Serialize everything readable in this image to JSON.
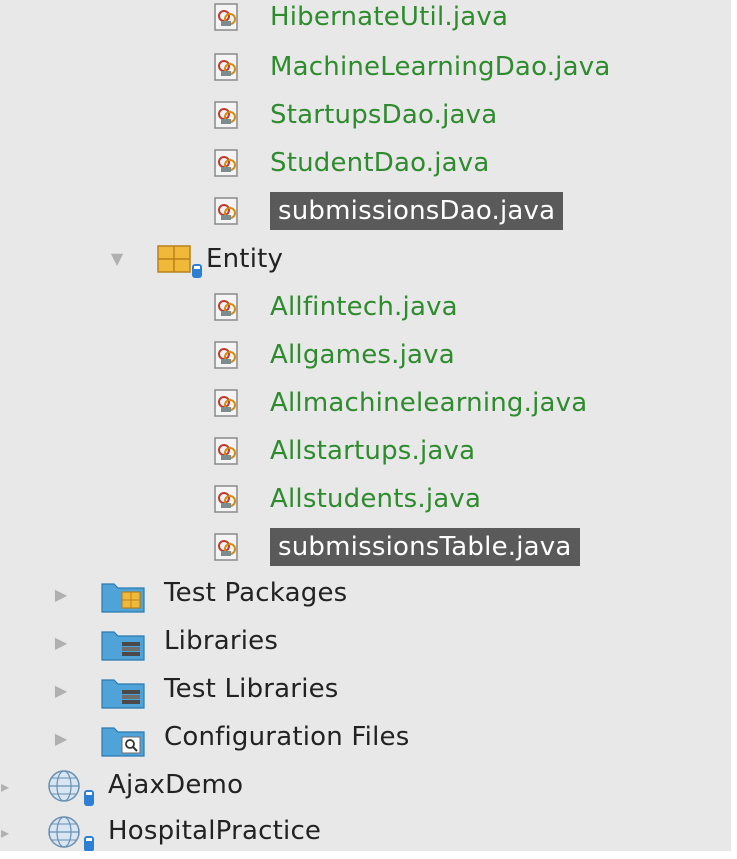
{
  "tree": {
    "dao_files": [
      {
        "label": "HibernateUtil.java",
        "selected": false
      },
      {
        "label": "MachineLearningDao.java",
        "selected": false
      },
      {
        "label": "StartupsDao.java",
        "selected": false
      },
      {
        "label": "StudentDao.java",
        "selected": false
      },
      {
        "label": "submissionsDao.java",
        "selected": true
      }
    ],
    "entity_package": {
      "label": "Entity"
    },
    "entity_files": [
      {
        "label": "Allfintech.java",
        "selected": false
      },
      {
        "label": "Allgames.java",
        "selected": false
      },
      {
        "label": "Allmachinelearning.java",
        "selected": false
      },
      {
        "label": "Allstartups.java",
        "selected": false
      },
      {
        "label": "Allstudents.java",
        "selected": false
      },
      {
        "label": "submissionsTable.java",
        "selected": true
      }
    ],
    "project_folders": [
      {
        "label": "Test Packages",
        "icon": "test-packages-folder-icon"
      },
      {
        "label": "Libraries",
        "icon": "libraries-folder-icon"
      },
      {
        "label": "Test Libraries",
        "icon": "test-libraries-folder-icon"
      },
      {
        "label": "Configuration Files",
        "icon": "configuration-folder-icon"
      }
    ],
    "projects": [
      {
        "label": "AjaxDemo"
      },
      {
        "label": "HospitalPractice"
      }
    ]
  },
  "colors": {
    "file_text": "#2e8b2e",
    "selection_bg": "#5a5a5a",
    "background": "#e8e8e8",
    "folder_blue": "#4fa3d9",
    "package_yellow": "#f1b93a"
  }
}
